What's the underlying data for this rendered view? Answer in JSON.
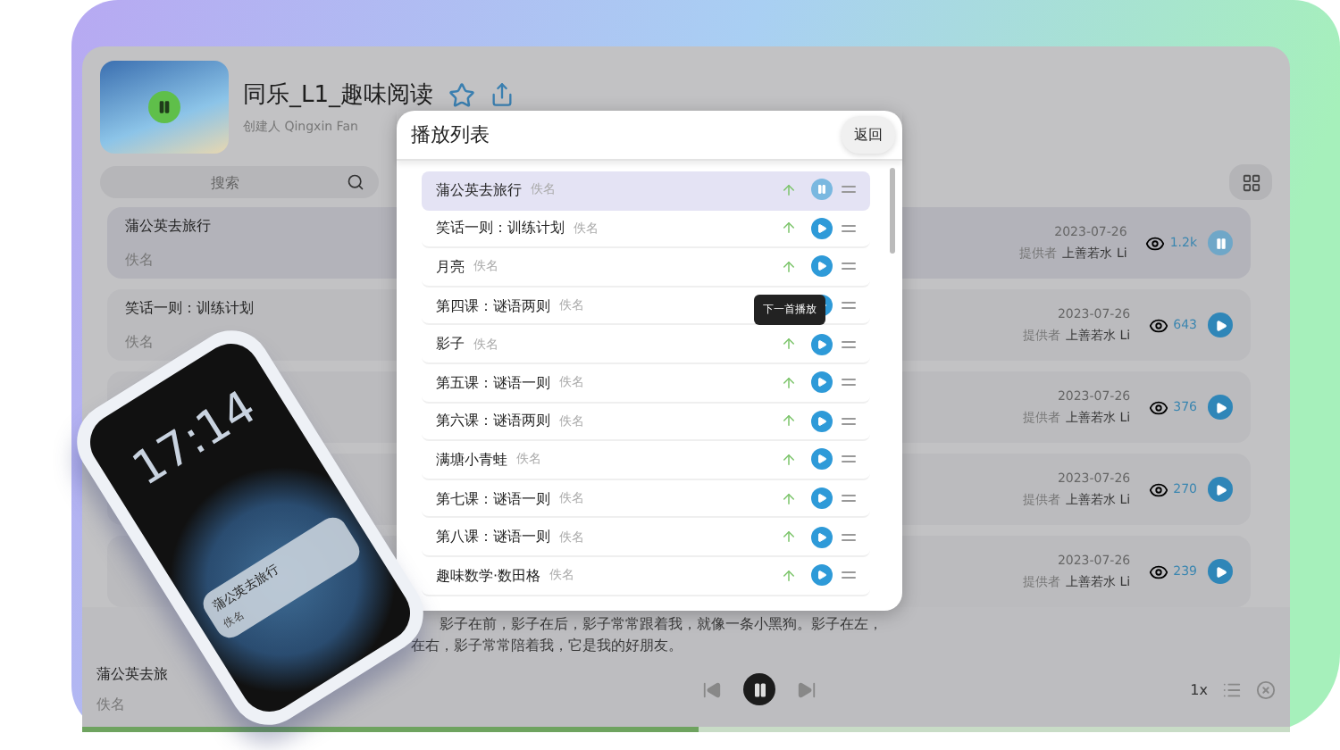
{
  "app": {
    "title": "同乐_L1_趣味阅读",
    "creator": "创建人 Qingxin Fan",
    "search_placeholder": "搜索"
  },
  "cards": [
    {
      "title": "蒲公英去旅行",
      "author": "佚名",
      "date": "2023-07-26",
      "provider_label": "提供者",
      "provider": "上善若水 Li",
      "views": "1.2k",
      "playing": true
    },
    {
      "title": "笑话一则：训练计划",
      "author": "佚名",
      "date": "2023-07-26",
      "provider_label": "提供者",
      "provider": "上善若水 Li",
      "views": "643",
      "playing": false
    },
    {
      "date": "2023-07-26",
      "provider_label": "提供者",
      "provider": "上善若水 Li",
      "views": "376",
      "playing": false
    },
    {
      "date": "2023-07-26",
      "provider_label": "提供者",
      "provider": "上善若水 Li",
      "views": "270",
      "playing": false
    },
    {
      "date": "2023-07-26",
      "provider_label": "提供者",
      "provider": "上善若水 Li",
      "views": "239",
      "playing": false
    }
  ],
  "playlist": {
    "title": "播放列表",
    "back": "返回",
    "tooltip": "下一首播放",
    "items": [
      {
        "title": "蒲公英去旅行",
        "author": "佚名",
        "selected": true
      },
      {
        "title": "笑话一则：训练计划",
        "author": "佚名",
        "selected": false
      },
      {
        "title": "月亮",
        "author": "佚名",
        "selected": false
      },
      {
        "title": "第四课：谜语两则",
        "author": "佚名",
        "selected": false
      },
      {
        "title": "影子",
        "author": "佚名",
        "selected": false
      },
      {
        "title": "第五课：谜语一则",
        "author": "佚名",
        "selected": false
      },
      {
        "title": "第六课：谜语两则",
        "author": "佚名",
        "selected": false
      },
      {
        "title": "满塘小青蛙",
        "author": "佚名",
        "selected": false
      },
      {
        "title": "第七课：谜语一则",
        "author": "佚名",
        "selected": false
      },
      {
        "title": "第八课：谜语一则",
        "author": "佚名",
        "selected": false
      },
      {
        "title": "趣味数学·数田格",
        "author": "佚名",
        "selected": false
      }
    ]
  },
  "player": {
    "lyrics": [
      "影子在前，影子在后，影子常常跟着我，就像一条小黑狗。影子在左，",
      "在右，影子常常陪着我，它是我的好朋友。"
    ],
    "title": "蒲公英去旅",
    "author": "佚名",
    "level": 0.51,
    "speed": "1x"
  },
  "phone": {
    "time": "17:14",
    "track": "蒲公英去旅行",
    "artist": "佚名"
  }
}
